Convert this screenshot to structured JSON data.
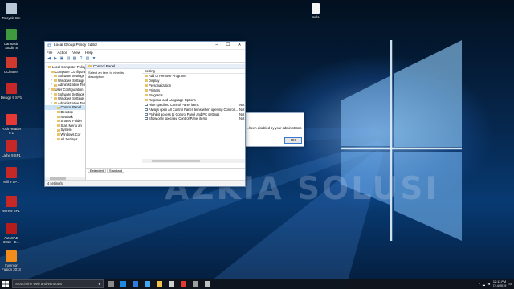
{
  "desktop": {
    "icons": [
      {
        "name": "Recycle Bin",
        "color": "#b9c7d6"
      },
      {
        "name": "Camtasia Studio 8",
        "color": "#3f9a3f"
      },
      {
        "name": "CCleaner",
        "color": "#d03a2e"
      },
      {
        "name": "Design 9 SP1",
        "color": "#c62828"
      },
      {
        "name": "Foxit Reader 9.1",
        "color": "#e53935"
      },
      {
        "name": "Lathe 9 SP1",
        "color": "#c62828"
      },
      {
        "name": "Mill 9 SP1",
        "color": "#c62828"
      },
      {
        "name": "Wire 9 SP1",
        "color": "#c62828"
      },
      {
        "name": "AutoCAD 2013 - E...",
        "color": "#b71c1c"
      },
      {
        "name": "Inventor Fusion 2013",
        "color": "#f28c1a"
      }
    ],
    "top_icon": {
      "name": "tesla",
      "color": "#ffffff"
    },
    "watermark": "AZKIA SOLUSI"
  },
  "gp_window": {
    "title": "Local Group Policy Editor",
    "menu": [
      "File",
      "Action",
      "View",
      "Help"
    ],
    "tree": [
      {
        "label": "Local Computer Policy",
        "depth": 0
      },
      {
        "label": "Computer Configurat",
        "depth": 1
      },
      {
        "label": "Software Settings",
        "depth": 2
      },
      {
        "label": "Windows Settings",
        "depth": 2
      },
      {
        "label": "Administrative Tem",
        "depth": 2
      },
      {
        "label": "User Configuration",
        "depth": 1
      },
      {
        "label": "Software Settings",
        "depth": 2
      },
      {
        "label": "Windows Settings",
        "depth": 2
      },
      {
        "label": "Administrative Tem",
        "depth": 2
      },
      {
        "label": "Control Panel",
        "depth": 3,
        "selected": true
      },
      {
        "label": "Desktop",
        "depth": 3
      },
      {
        "label": "Network",
        "depth": 3
      },
      {
        "label": "Shared Folder",
        "depth": 3
      },
      {
        "label": "Start Menu an",
        "depth": 3
      },
      {
        "label": "System",
        "depth": 3
      },
      {
        "label": "Windows Cor",
        "depth": 3
      },
      {
        "label": "All Settings",
        "depth": 3
      }
    ],
    "detail_header": "Control Panel",
    "description_hint": "Select an item to view its description.",
    "setting_column": "Setting",
    "settings": [
      {
        "label": "Add or Remove Programs",
        "kind": "folder",
        "state": ""
      },
      {
        "label": "Display",
        "kind": "folder",
        "state": ""
      },
      {
        "label": "Personalization",
        "kind": "folder",
        "state": ""
      },
      {
        "label": "Printers",
        "kind": "folder",
        "state": ""
      },
      {
        "label": "Programs",
        "kind": "folder",
        "state": ""
      },
      {
        "label": "Regional and Language Options",
        "kind": "folder",
        "state": ""
      },
      {
        "label": "Hide specified Control Panel items",
        "kind": "policy",
        "state": "Not"
      },
      {
        "label": "Always open All Control Panel Items when opening Control ...",
        "kind": "policy",
        "state": "Not"
      },
      {
        "label": "Prohibit access to Control Panel and PC settings",
        "kind": "policy",
        "state": "Not"
      },
      {
        "label": "Show only specified Control Panel items",
        "kind": "policy",
        "state": "Not"
      }
    ],
    "tabs": [
      "Extended",
      "Standard"
    ],
    "status": "4 setting(s)"
  },
  "dialog": {
    "message": "...been disabled by your administrator.",
    "ok_label": "OK"
  },
  "taskbar": {
    "search_placeholder": "Search the web and Windows",
    "clock_time": "12:13 PM",
    "clock_date": "7/14/2019",
    "pinned_colors": [
      "#8a8a8a",
      "#1e88e5",
      "#2d7de1",
      "#42a5f5",
      "#f0c24b",
      "#cfcfcf",
      "#e53935",
      "#9e9e9e",
      "#c0c0c0"
    ]
  },
  "colors": {
    "accent": "#0078d7",
    "selection": "#cce4f7"
  }
}
